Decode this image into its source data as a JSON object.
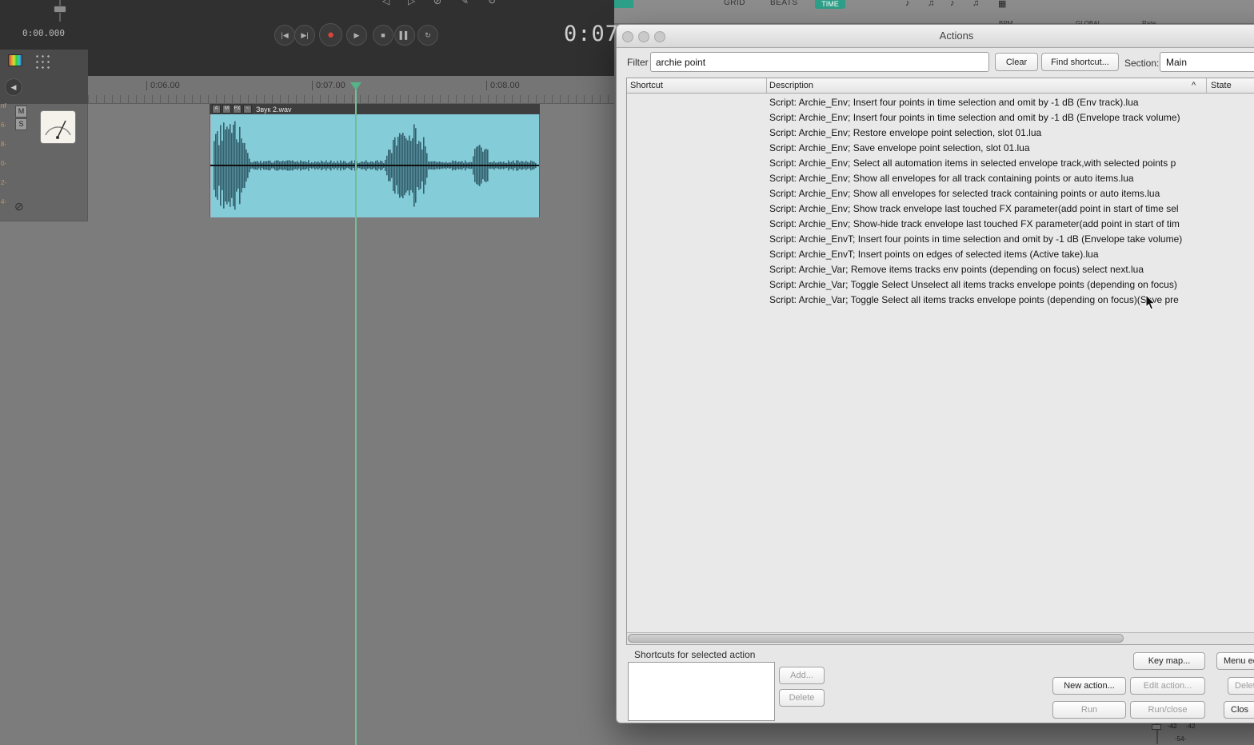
{
  "reaper": {
    "small_timecode": "0:00.000",
    "big_timecode": "0:07.",
    "transport": {
      "buttons": [
        {
          "name": "go-to-start-button",
          "glyph": "|◀"
        },
        {
          "name": "go-to-end-button",
          "glyph": "▶|"
        },
        {
          "name": "record-button",
          "glyph": "●"
        },
        {
          "name": "play-button",
          "glyph": "▶"
        },
        {
          "name": "stop-button",
          "glyph": "■"
        },
        {
          "name": "pause-button",
          "glyph": "▌▌"
        },
        {
          "name": "repeat-button",
          "glyph": "↻"
        }
      ]
    },
    "ruler_marks": [
      "0:06.00",
      "0:07.00",
      "0:08.00"
    ],
    "left_scale": [
      "nf",
      "6-",
      "8-",
      "0-",
      "2-",
      "4-"
    ],
    "track": {
      "mute": "M",
      "solo": "S",
      "bypass_glyph": "⊘",
      "collapse_glyph": "◀"
    },
    "item": {
      "label": "Звук 2.wav",
      "icons": [
        "A",
        "M",
        "FX",
        "~"
      ]
    },
    "topbar": {
      "grid": "GRID",
      "beats": "BEATS",
      "time": "TIME",
      "bpm": "BPM",
      "global": "GLOBAL",
      "rate": "Rate:",
      "partial_icons": [
        "◁",
        "▷",
        "⊘",
        "✎",
        "↻"
      ],
      "note_icons": [
        "♪",
        "♫",
        "♪",
        "♫",
        "▦"
      ]
    },
    "meters": {
      "left": "-42",
      "right": "-42",
      "bottom": "-54-"
    }
  },
  "actions": {
    "title": "Actions",
    "filter_label": "Filter",
    "filter_value": "archie point",
    "clear_button": "Clear",
    "find_shortcut_button": "Find shortcut...",
    "section_label": "Section:",
    "section_value": "Main",
    "columns": {
      "shortcut": "Shortcut",
      "description": "Description",
      "state": "State",
      "sort_indicator": "^"
    },
    "rows": [
      "Script: Archie_Env;  Insert four points in time selection and omit by -1 dB (Env track).lua",
      "Script: Archie_Env;  Insert four points in time selection and omit by -1 dB (Envelope track volume)",
      "Script: Archie_Env;  Restore envelope point selection, slot 01.lua",
      "Script: Archie_Env;  Save envelope point selection, slot 01.lua",
      "Script: Archie_Env;  Select all automation items in selected envelope track,with selected  points p",
      "Script: Archie_Env;  Show all envelopes for all track containing points or auto items.lua",
      "Script: Archie_Env;  Show all envelopes for selected track containing points or auto items.lua",
      "Script: Archie_Env;  Show track envelope last touched FX parameter(add point in start of time sel",
      "Script: Archie_Env;  Show-hide track envelope last touched FX parameter(add point in start of tim",
      "Script: Archie_EnvT;  Insert four points in time selection and omit by -1 dB (Envelope take volume)",
      "Script: Archie_EnvT;  Insert points on edges of selected items (Active take).lua",
      "Script: Archie_Var;  Remove items tracks env points (depending on focus) select next.lua",
      "Script: Archie_Var;  Toggle Select Unselect all items tracks envelope points (depending on focus)",
      "Script: Archie_Var;  Toggle Select all items tracks envelope points (depending on focus)(Save pre"
    ],
    "shortcuts_label": "Shortcuts for selected action",
    "add_button": "Add...",
    "delete_shortcut_button": "Delete",
    "key_map_button": "Key map...",
    "menu_editor_button": "Menu ed",
    "new_action_button": "New action...",
    "edit_action_button": "Edit action...",
    "delete_action_button": "Delet",
    "run_button": "Run",
    "run_close_button": "Run/close",
    "close_button": "Clos"
  }
}
